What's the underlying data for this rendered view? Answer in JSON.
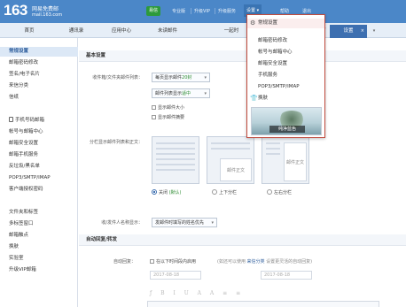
{
  "header": {
    "logo_number": "163",
    "logo_name": "网易免费邮",
    "logo_domain": "mail.163.com",
    "user_email": "",
    "vip_badge": "易信",
    "links": {
      "pro": "专业版",
      "upgrade_vip": "升级VIP",
      "upgrade_service": "升级服务",
      "settings": "设置",
      "help": "帮助",
      "logout": "退出"
    }
  },
  "tabs": {
    "items": [
      {
        "label": "首页"
      },
      {
        "label": "通讯录"
      },
      {
        "label": "应用中心"
      },
      {
        "label": "未读邮件"
      },
      {
        "label": "一起时"
      },
      {
        "label": "写"
      },
      {
        "label": "设置"
      }
    ],
    "close_symbol": "×",
    "more_symbol": "▾"
  },
  "sidebar": {
    "items": [
      "常规设置",
      "邮箱密码修改",
      "签名/电子名片",
      "来信分类",
      "信纸",
      "手机号码邮箱",
      "帐号与邮箱中心",
      "邮箱安全设置",
      "邮箱手机服务",
      "反垃圾/黑名单",
      "POP3/SMTP/IMAP",
      "客户端授权密码",
      "文件夹和标签",
      "多标签窗口",
      "邮箱触点",
      "换肤",
      "实验室",
      "升级VIP邮箱"
    ]
  },
  "main": {
    "basic_section_title": "基本设置",
    "list_label": "收件箱/文件夹邮件列表：",
    "per_page_prefix": "每页显示邮件",
    "per_page_count": "20封",
    "list_display_prefix": "邮件列表显示",
    "list_display_value": "适中",
    "show_size": "显示邮件大小",
    "show_summary": "显示邮件摘要",
    "split_label": "分栏显示邮件列表和正文：",
    "layout_options": [
      {
        "label": "关闭",
        "note": "(默认)",
        "selected": true,
        "panel_text": ""
      },
      {
        "label": "上下分栏",
        "selected": false,
        "panel_text": "邮件正文"
      },
      {
        "label": "左右分栏",
        "selected": false,
        "panel_text": "邮件正文"
      }
    ],
    "sender_label": "收/发件人名称显示：",
    "sender_value": "发邮件时填写的姓名优先",
    "auto_section_title": "自动回复/转发",
    "auto_reply_label": "自动回复：",
    "auto_reply_text": "在以下时间段内启用",
    "auto_reply_note": "(如还可以使用",
    "auto_reply_link": "来信分类",
    "auto_reply_note2": "设置更灵活的自动回复)",
    "date_start": "2017-08-18",
    "date_end": "2017-08-18",
    "editor_tools": "ƒ B I U A A ≡ ≡"
  },
  "dropdown": {
    "items": [
      {
        "label": "常规设置",
        "active": true
      },
      {
        "label": "邮箱密码修改",
        "active": false
      },
      {
        "label": "帐号与邮箱中心",
        "active": false
      },
      {
        "label": "邮箱安全设置",
        "active": false
      },
      {
        "label": "手机服务",
        "active": false
      },
      {
        "label": "POP3/SMTP/IMAP",
        "active": false
      },
      {
        "label": "换肤",
        "active": false
      }
    ],
    "skin_caption": "纯净蓝色"
  }
}
